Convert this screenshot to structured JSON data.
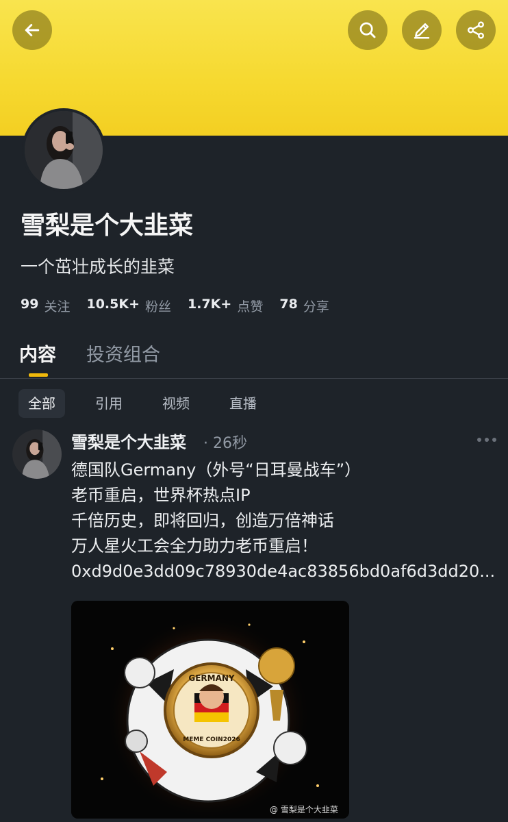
{
  "header": {
    "back_icon": "back-arrow-icon",
    "actions": [
      "search-icon",
      "edit-icon",
      "share-icon"
    ],
    "banner_color": "#f6d930"
  },
  "profile": {
    "name": "雪梨是个大韭菜",
    "bio": "一个茁壮成长的韭菜",
    "stats": [
      {
        "value": "99",
        "label": "关注"
      },
      {
        "value": "10.5K+",
        "label": "粉丝"
      },
      {
        "value": "1.7K+",
        "label": "点赞"
      },
      {
        "value": "78",
        "label": "分享"
      }
    ]
  },
  "tabs": [
    {
      "label": "内容",
      "active": true
    },
    {
      "label": "投资组合",
      "active": false
    }
  ],
  "filters": [
    {
      "label": "全部",
      "active": true
    },
    {
      "label": "引用",
      "active": false
    },
    {
      "label": "视频",
      "active": false
    },
    {
      "label": "直播",
      "active": false
    }
  ],
  "post": {
    "author": "雪梨是个大韭菜",
    "time": "· 26秒",
    "lines": [
      "德国队Germany（外号“日耳曼战车”）",
      "老币重启，世界杯热点IP",
      "千倍历史，即将回归，创造万倍神话",
      "万人星火工会全力助力老币重启！",
      "0xd9d0e3dd09c78930de4ac83856bd0af6d3dd20..."
    ],
    "image": {
      "badge_top": "GERMANY",
      "badge_bottom": "MEME COIN2026",
      "watermark": "@ 雪梨是个大韭菜"
    }
  },
  "colors": {
    "background": "#1e2329",
    "accent": "#f0b90b",
    "muted_text": "#929aa5"
  }
}
